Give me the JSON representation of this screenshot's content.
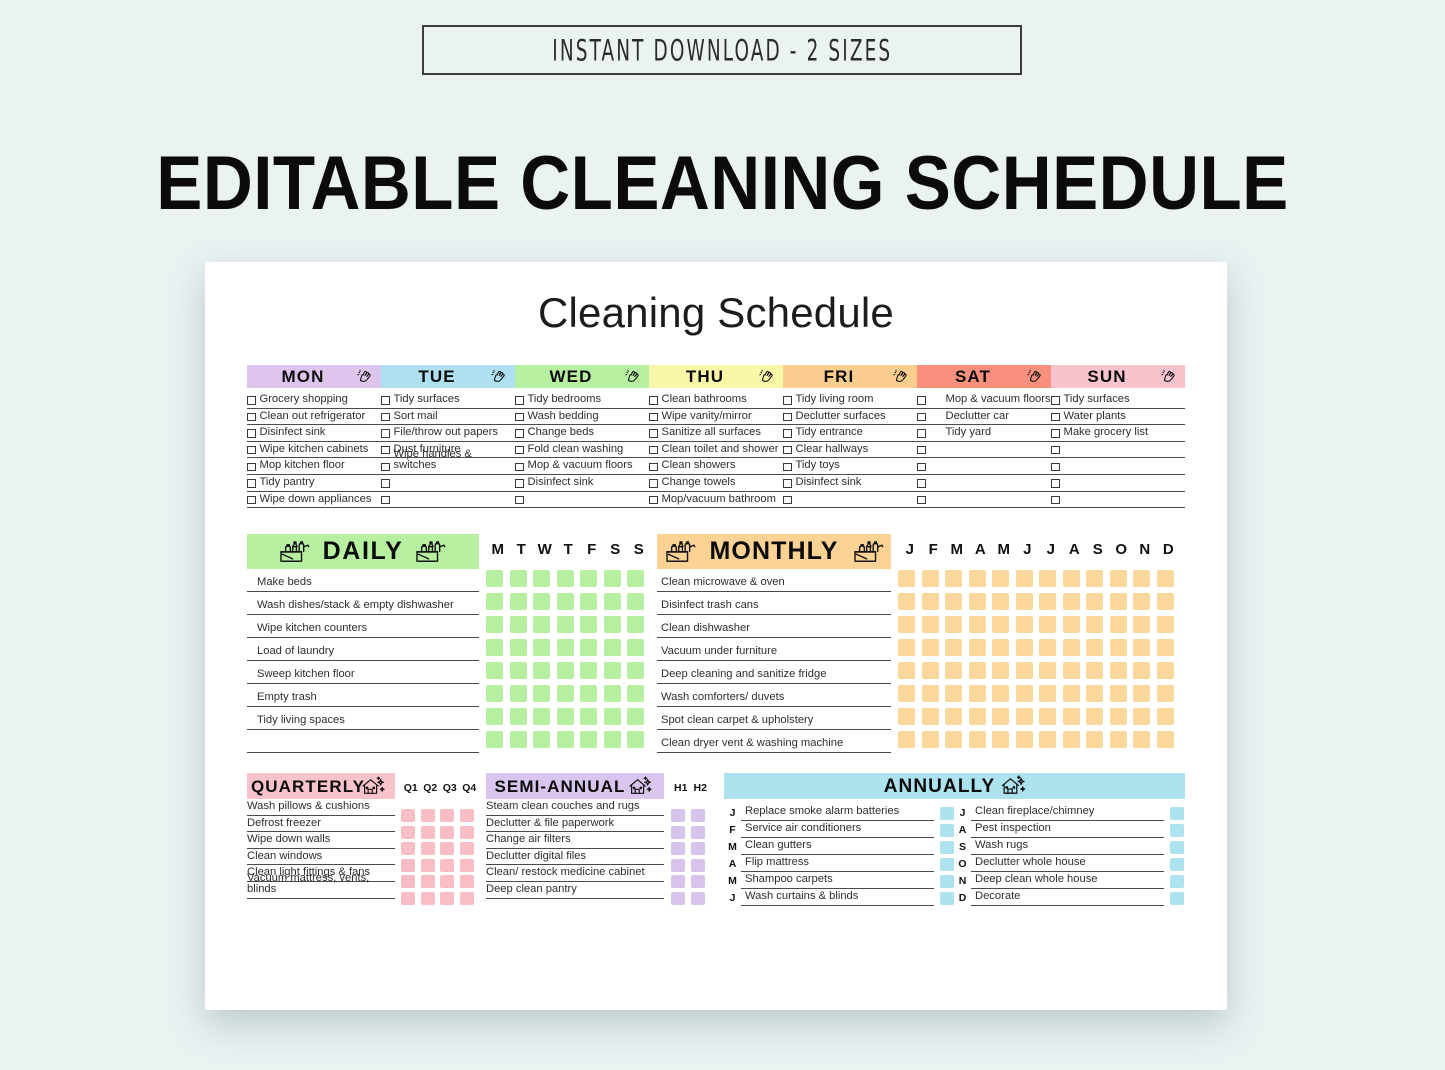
{
  "banner": {
    "text": "INSTANT DOWNLOAD - 2 SIZES"
  },
  "main_title": "EDITABLE CLEANING SCHEDULE",
  "sheet_title": "Cleaning Schedule",
  "colors": {
    "background": "#EAF2F2",
    "card": "#FFFFFF",
    "mon": "#DEC5EE",
    "tue": "#AEE0F0",
    "wed": "#B7F0A0",
    "thu": "#FBF7A8",
    "fri": "#FBCD8E",
    "sat": "#F9907E",
    "sun": "#F8C3CC",
    "daily_cell": "#B6EFA0",
    "monthly_cell": "#FBD79B",
    "quarterly_cell": "#F9BEC5",
    "semi_cell": "#D7C4EC",
    "annual_cell": "#ADE3EE"
  },
  "days": [
    {
      "name": "MON",
      "color": "#DEC5EE",
      "icon": "spray-hand-icon",
      "tasks": [
        "Grocery shopping",
        "Clean out refrigerator",
        "Disinfect sink",
        "Wipe kitchen cabinets",
        "Mop kitchen floor",
        "Tidy pantry",
        "Wipe down appliances"
      ]
    },
    {
      "name": "TUE",
      "color": "#AEE0F0",
      "icon": "spray-hand-icon",
      "tasks": [
        "Tidy surfaces",
        "Sort mail",
        "File/throw out papers",
        "Dust furniture",
        "Wipe handles & switches",
        "",
        ""
      ]
    },
    {
      "name": "WED",
      "color": "#B7F0A0",
      "icon": "spray-hand-icon",
      "tasks": [
        "Tidy bedrooms",
        "Wash bedding",
        "Change beds",
        "Fold clean washing",
        "Mop & vacuum floors",
        "Disinfect sink",
        ""
      ]
    },
    {
      "name": "THU",
      "color": "#FBF7A8",
      "icon": "spray-hand-icon",
      "tasks": [
        "Clean bathrooms",
        "Wipe vanity/mirror",
        "Sanitize all surfaces",
        "Clean toilet and shower",
        "Clean showers",
        "Change towels",
        "Mop/vacuum bathroom"
      ]
    },
    {
      "name": "FRI",
      "color": "#FBCD8E",
      "icon": "spray-hand-icon",
      "tasks": [
        "Tidy living room",
        "Declutter surfaces",
        "Tidy entrance",
        "Clear hallways",
        "Tidy toys",
        "Disinfect sink",
        ""
      ]
    },
    {
      "name": "SAT",
      "color": "#F9907E",
      "icon": "spray-hand-icon",
      "tasks": [
        "Mop & vacuum floors",
        "Declutter car",
        "Tidy yard",
        "",
        "",
        "",
        ""
      ]
    },
    {
      "name": "SUN",
      "color": "#F8C3CC",
      "icon": "spray-hand-icon",
      "tasks": [
        "Tidy surfaces",
        "Water plants",
        "Make grocery list",
        "",
        "",
        "",
        ""
      ]
    }
  ],
  "daily": {
    "title": "DAILY",
    "icon": "cleaning-caddy-icon",
    "tasks": [
      "Make beds",
      "Wash dishes/stack & empty dishwasher",
      "Wipe kitchen counters",
      "Load of laundry",
      "Sweep kitchen floor",
      "Empty trash",
      "Tidy living spaces",
      ""
    ],
    "grid_columns": [
      "M",
      "T",
      "W",
      "T",
      "F",
      "S",
      "S"
    ],
    "grid_rows": 8
  },
  "monthly": {
    "title": "MONTHLY",
    "icon": "cleaning-caddy-icon",
    "tasks": [
      "Clean microwave & oven",
      "Disinfect trash cans",
      "Clean dishwasher",
      "Vacuum under furniture",
      "Deep cleaning and sanitize fridge",
      "Wash comforters/ duvets",
      "Spot clean carpet & upholstery",
      "Clean dryer vent & washing machine"
    ],
    "grid_columns": [
      "J",
      "F",
      "M",
      "A",
      "M",
      "J",
      "J",
      "A",
      "S",
      "O",
      "N",
      "D"
    ],
    "grid_rows": 8
  },
  "quarterly": {
    "title": "QUARTERLY",
    "icon": "sparkle-house-icon",
    "tasks": [
      "Wash pillows & cushions",
      "Defrost freezer",
      "Wipe down walls",
      "Clean windows",
      "Clean light fittings & fans",
      "Vacuum mattress, vents, blinds"
    ],
    "grid_columns": [
      "Q1",
      "Q2",
      "Q3",
      "Q4"
    ],
    "grid_rows": 6
  },
  "semi_annual": {
    "title": "SEMI-ANNUAL",
    "icon": "sparkle-house-icon",
    "tasks": [
      "Steam clean couches and rugs",
      "Declutter & file paperwork",
      "Change air filters",
      "Declutter digital files",
      "Clean/ restock medicine cabinet",
      "Deep clean pantry"
    ],
    "grid_columns": [
      "H1",
      "H2"
    ],
    "grid_rows": 6
  },
  "annually": {
    "title": "ANNUALLY",
    "icon": "sparkle-house-icon",
    "left": [
      {
        "month": "J",
        "task": "Replace smoke alarm batteries"
      },
      {
        "month": "F",
        "task": "Service air conditioners"
      },
      {
        "month": "M",
        "task": "Clean gutters"
      },
      {
        "month": "A",
        "task": "Flip mattress"
      },
      {
        "month": "M",
        "task": "Shampoo carpets"
      },
      {
        "month": "J",
        "task": "Wash curtains & blinds"
      }
    ],
    "right": [
      {
        "month": "J",
        "task": "Clean fireplace/chimney"
      },
      {
        "month": "A",
        "task": "Pest inspection"
      },
      {
        "month": "S",
        "task": "Wash rugs"
      },
      {
        "month": "O",
        "task": "Declutter whole house"
      },
      {
        "month": "N",
        "task": "Deep clean whole house"
      },
      {
        "month": "D",
        "task": "Decorate"
      }
    ]
  }
}
